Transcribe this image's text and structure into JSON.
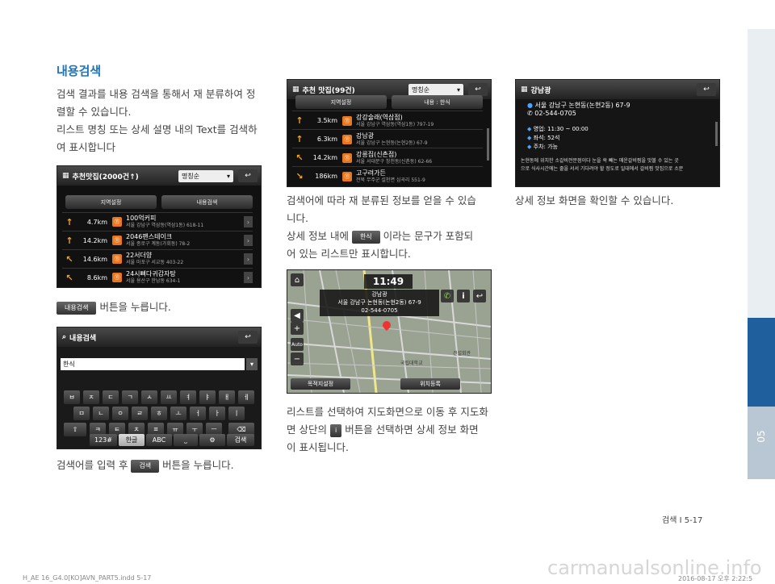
{
  "section_title": "내용검색",
  "col1": {
    "p1": [
      "검색 결과를 내용 검색을 통해서 재 분류하여 정",
      "렬할 수 있습니다.",
      "리스트 명칭 또는 상세 설명 내의 Text를 검색하",
      "여 표시합니다"
    ],
    "screen1": {
      "title": "추천맛집(2000건↑)",
      "sort": "명칭순",
      "tabs": [
        "지역설정",
        "내용검색"
      ],
      "rows": [
        {
          "dist": "4.7km",
          "name": "100억커피",
          "addr": "서울 강남구 역삼동(역삼1동) 618-11"
        },
        {
          "dist": "14.2km",
          "name": "2046팬스테이크",
          "addr": "서울 종로구 계동(가회동) 78-2"
        },
        {
          "dist": "14.6km",
          "name": "22서더양",
          "addr": "서울 마포구 서교동 403-22"
        },
        {
          "dist": "8.6km",
          "name": "24시뼈다귀감자탕",
          "addr": "서울 용산구 한남동 634-1"
        }
      ]
    },
    "btn_label": "내용검색",
    "caption1_tail": "버튼을 누릅니다.",
    "screen2": {
      "title": "내용검색",
      "input": "한식",
      "keys_row1": [
        "ㅂ",
        "ㅈ",
        "ㄷ",
        "ㄱ",
        "ㅅ",
        "ㅛ",
        "ㅕ",
        "ㅑ",
        "ㅐ",
        "ㅔ"
      ],
      "keys_row2": [
        "ㅁ",
        "ㄴ",
        "ㅇ",
        "ㄹ",
        "ㅎ",
        "ㅗ",
        "ㅓ",
        "ㅏ",
        "ㅣ"
      ],
      "keys_row3": [
        "ㅋ",
        "ㅌ",
        "ㅊ",
        "ㅍ",
        "ㅠ",
        "ㅜ",
        "ㅡ"
      ],
      "keys_row4": [
        "123#",
        "한글",
        "ABC",
        "검색"
      ]
    },
    "caption2_head": "검색어를 입력 후",
    "search_btn": "검색",
    "caption2_tail": "버튼을 누릅니다."
  },
  "col2": {
    "screen3": {
      "title": "추천 맛집(99건)",
      "sort": "명칭순",
      "tabs": [
        "지역설정",
        "내용 : 한식"
      ],
      "rows": [
        {
          "dist": "3.5km",
          "name": "강강술래(역삼점)",
          "addr": "서울 강남구 역삼동(역삼1동) 797-19"
        },
        {
          "dist": "6.3km",
          "name": "강남광",
          "addr": "서울 강남구 논현동(논현2동) 67-9"
        },
        {
          "dist": "14.2km",
          "name": "강릉집(신촌점)",
          "addr": "서울 서대문구 창천동(신촌동) 62-66"
        },
        {
          "dist": "186km",
          "name": "고구려가든",
          "addr": "전북 무주군 설천면 심곡리 551-9"
        }
      ]
    },
    "p2a": [
      "검색어에 따라 재 분류된 정보를 얻을 수 있습",
      "니다."
    ],
    "p2b_head": "상세 정보 내에",
    "hansik_btn": "한식",
    "p2b_tail": "이라는 문구가 포함되",
    "p2c": "어 있는 리스트만 표시합니다.",
    "map": {
      "time": "11:49",
      "name": "강남광",
      "addr": "서울 강남구 논현동(논현2동) 67-9",
      "phone": "02-544-0705",
      "btn_left": "목적지설정",
      "btn_right": "위치등록",
      "auto": "Auto",
      "road1": "국립대학교",
      "road2": "건설회관"
    },
    "p3a": "리스트를 선택하여 지도화면으로 이동 후 지도화",
    "p3b_head": "면 상단의",
    "info_btn": "i",
    "p3b_tail": "버튼을 선택하면 상세 정보 화면",
    "p3c": "이 표시됩니다."
  },
  "col3": {
    "screen4": {
      "title": "강남광",
      "addr": "서울 강남구 논현동(논현2동) 67-9",
      "phone": "02-544-0705",
      "hours": "영업: 11:30 ~ 00:00",
      "seats": "좌석: 52석",
      "parking": "주차: 가능",
      "desc1": "논현동에 위치한 소갈비전문점이다 눈을 쏙 빼는 매운갈비찜을 맛볼 수 있는 곳",
      "desc2": "으로 식사시간에는 줄을 서서 기다려야 할 정도로 일대에서 갈비찜 맛집으로 소문"
    },
    "caption": "상세 정보 화면을 확인할 수 있습니다."
  },
  "page_footer": "검색 I 5-17",
  "chapter": "05",
  "bottom_left": "H_AE 16_G4.0[KO]AVN_PART5.indd   5-17",
  "bottom_right": "2016-08-17   오후 2:22:5",
  "watermark": "carmanualsonline.info"
}
